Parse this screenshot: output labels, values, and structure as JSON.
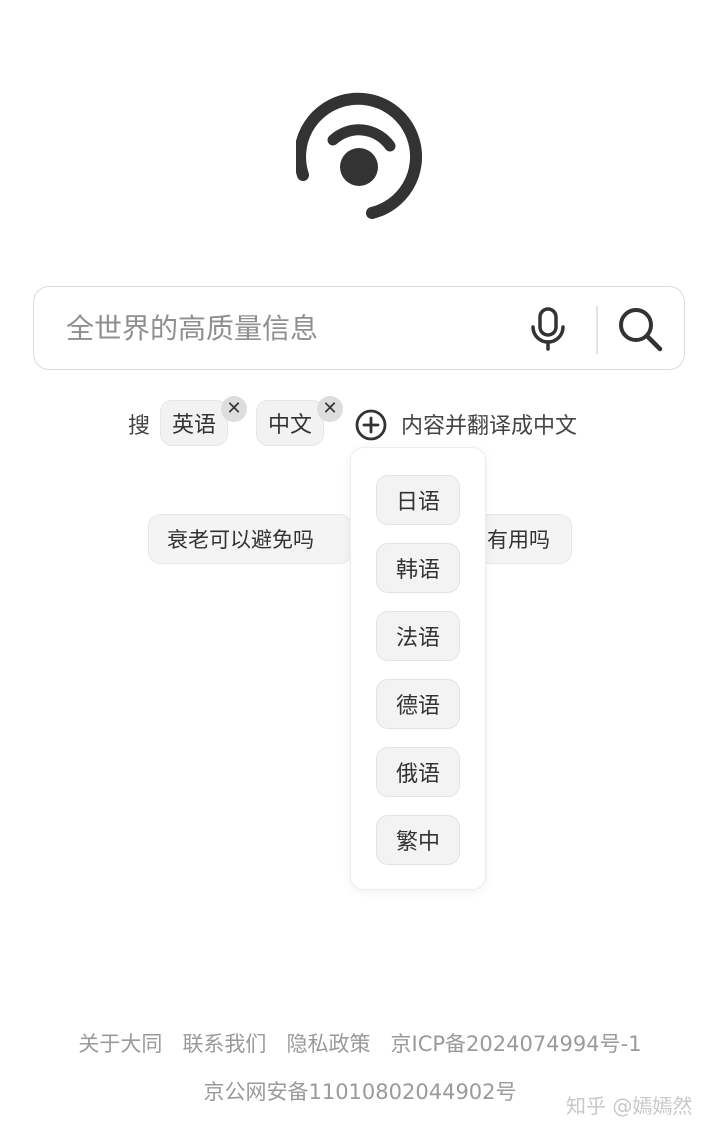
{
  "search": {
    "placeholder": "全世界的高质量信息"
  },
  "translate": {
    "prefix": "搜",
    "selected": [
      "英语",
      "中文"
    ],
    "suffix": "内容并翻译成中文"
  },
  "suggestions": [
    "衰老可以避免吗",
    "有用吗"
  ],
  "language_dropdown": {
    "options": [
      "日语",
      "韩语",
      "法语",
      "德语",
      "俄语",
      "繁中"
    ]
  },
  "footer": {
    "links": [
      "关于大同",
      "联系我们",
      "隐私政策"
    ],
    "icp": "京ICP备2024074994号-1",
    "police": "京公网安备11010802044902号"
  },
  "watermark": "知乎 @嫣嫣然",
  "colors": {
    "icon": "#333333",
    "chip_bg": "#f2f2f2",
    "border": "#dcdcdc",
    "footer_text": "#9a9a9a"
  },
  "icons": {
    "logo": "logo-icon",
    "mic": "microphone-icon",
    "search": "search-icon",
    "add": "add-circle-icon",
    "remove": "close-icon"
  }
}
